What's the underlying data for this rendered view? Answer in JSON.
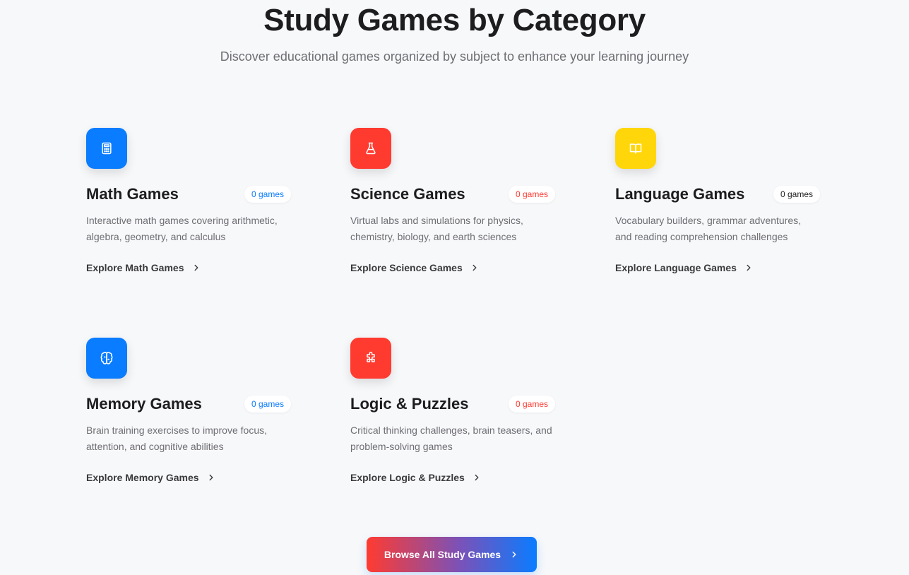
{
  "header": {
    "title": "Study Games by Category",
    "subtitle": "Discover educational games organized by subject to enhance your learning journey"
  },
  "categories": [
    {
      "title": "Math Games",
      "count": "0 games",
      "description": "Interactive math games covering arithmetic, algebra, geometry, and calculus",
      "link": "Explore Math Games",
      "icon": "calculator-icon",
      "color": "#0a7cff"
    },
    {
      "title": "Science Games",
      "count": "0 games",
      "description": "Virtual labs and simulations for physics, chemistry, biology, and earth sciences",
      "link": "Explore Science Games",
      "icon": "flask-icon",
      "color": "#ff3b30"
    },
    {
      "title": "Language Games",
      "count": "0 games",
      "description": "Vocabulary builders, grammar adventures, and reading comprehension challenges",
      "link": "Explore Language Games",
      "icon": "book-icon",
      "color": "#ffd60a"
    },
    {
      "title": "Memory Games",
      "count": "0 games",
      "description": "Brain training exercises to improve focus, attention, and cognitive abilities",
      "link": "Explore Memory Games",
      "icon": "brain-icon",
      "color": "#0a7cff"
    },
    {
      "title": "Logic & Puzzles",
      "count": "0 games",
      "description": "Critical thinking challenges, brain teasers, and problem-solving games",
      "link": "Explore Logic & Puzzles",
      "icon": "puzzle-icon",
      "color": "#ff3b30"
    }
  ],
  "cta": {
    "label": "Browse All Study Games",
    "icon": "chevron-right-icon"
  }
}
